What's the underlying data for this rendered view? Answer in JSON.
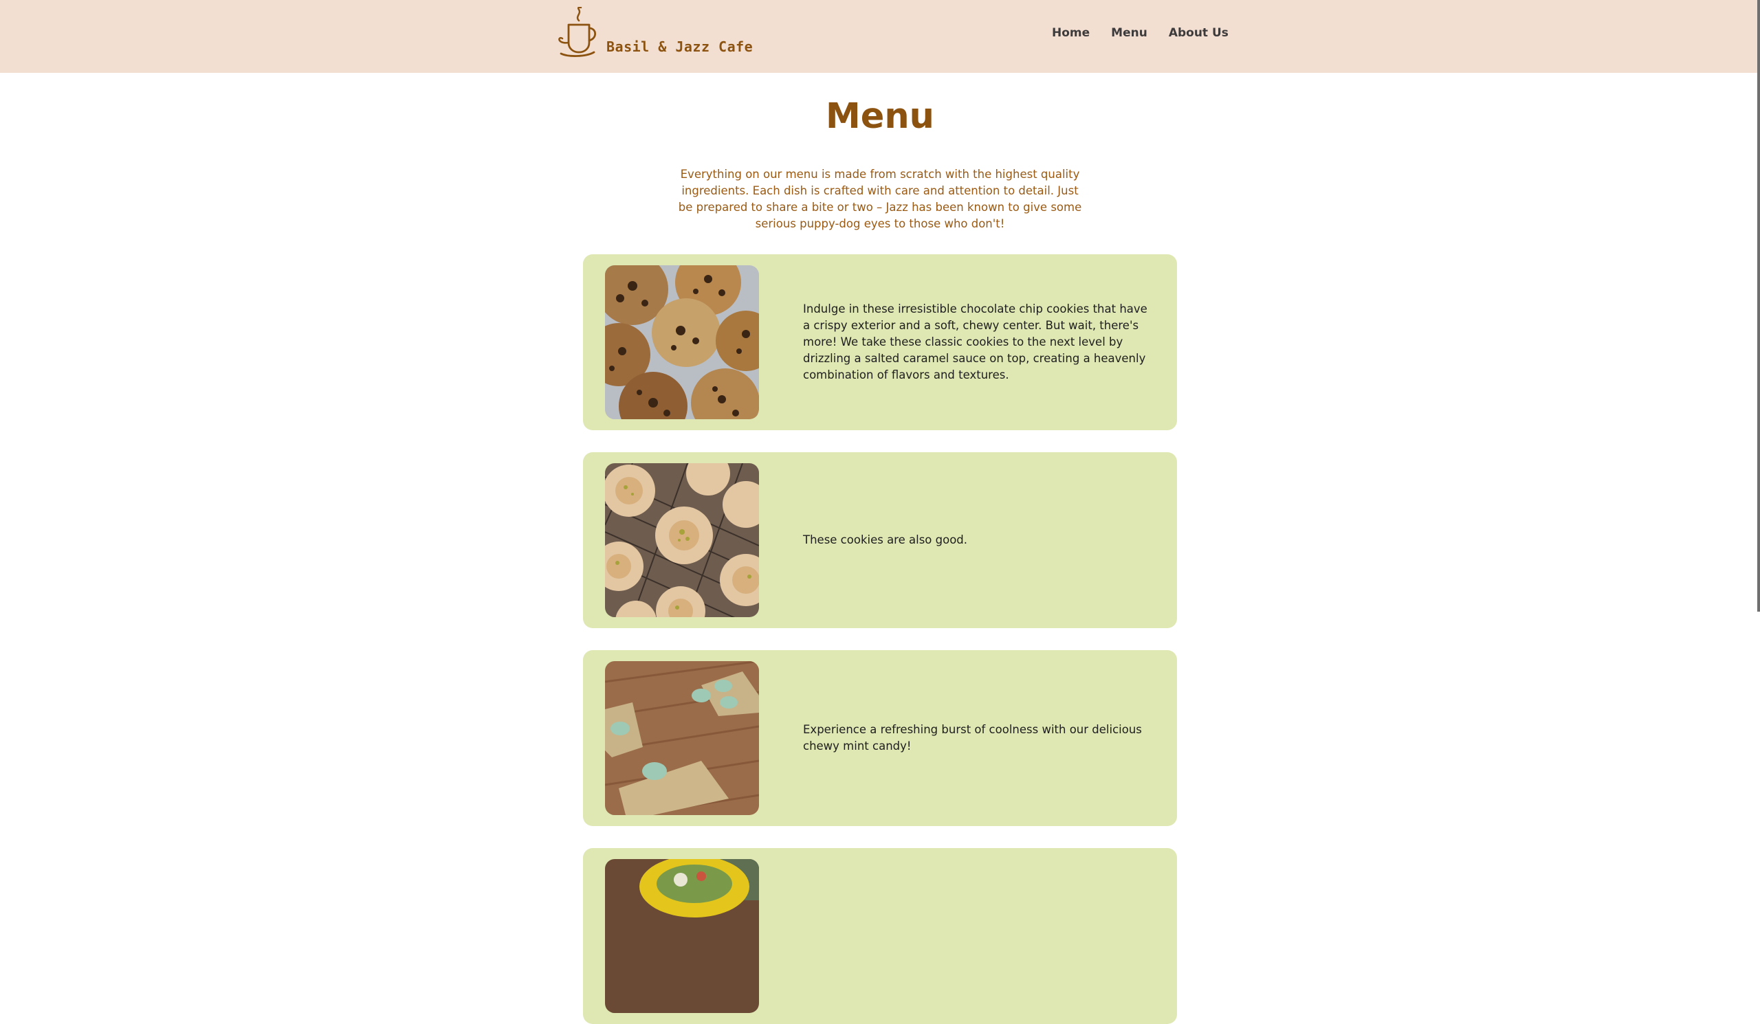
{
  "site": {
    "name": "Basil & Jazz Cafe",
    "logo_icon": "coffee-cup-icon",
    "brand_color": "#8c5310",
    "header_color": "#f3dfd2",
    "card_color": "#dfe7b3"
  },
  "nav": {
    "items": [
      "Home",
      "Menu",
      "About Us"
    ]
  },
  "page": {
    "title": "Menu",
    "intro": "Everything on our menu is made from scratch with the highest quality ingredients. Each dish is crafted with care and attention to detail. Just be prepared to share a bite or two – Jazz has been known to give some serious puppy-dog eyes to those who don't!"
  },
  "menu_items": [
    {
      "photo": "chocolate-chip-cookies-photo",
      "description": "Indulge in these irresistible chocolate chip cookies that have a crispy exterior and a soft, chewy center. But wait, there's more! We take these classic cookies to the next level by drizzling a salted caramel sauce on top, creating a heavenly combination of flavors and textures."
    },
    {
      "photo": "frosted-cookies-photo",
      "description": "These cookies are also good."
    },
    {
      "photo": "mint-candy-photo",
      "description": "Experience a refreshing burst of coolness with our delicious chewy mint candy!"
    },
    {
      "photo": "plated-dish-photo",
      "description": ""
    }
  ]
}
